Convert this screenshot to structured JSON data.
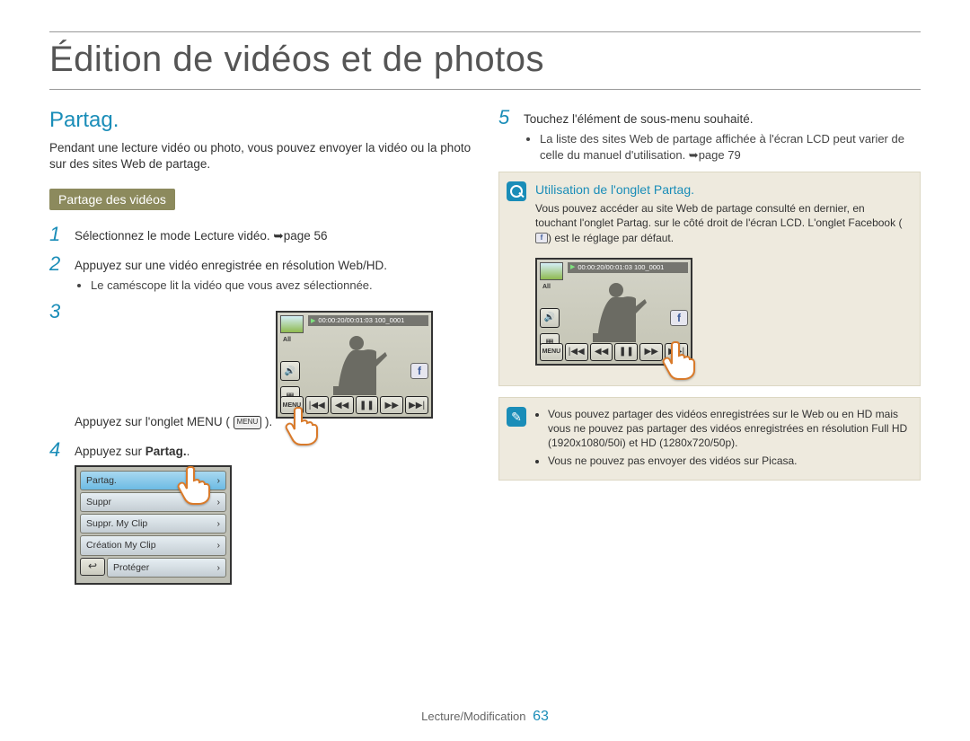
{
  "page_title": "Édition de vidéos et de photos",
  "section_heading": "Partag.",
  "intro": "Pendant une lecture vidéo ou photo, vous pouvez envoyer la vidéo ou la photo sur des sites Web de partage.",
  "sub_badge": "Partage des vidéos",
  "steps": {
    "1": {
      "text": "Sélectionnez le mode Lecture vidéo. ➥page 56"
    },
    "2": {
      "text": "Appuyez sur une vidéo enregistrée en résolution Web/HD.",
      "bullet": "Le caméscope lit la vidéo que vous avez sélectionnée."
    },
    "3": {
      "text_before": "Appuyez sur l'onglet MENU (",
      "text_after": ")."
    },
    "4": {
      "text_before": "Appuyez sur ",
      "bold": "Partag.",
      "text_after": "."
    },
    "5": {
      "text": "Touchez l'élément de sous-menu souhaité.",
      "bullet": "La liste des sites Web de partage affichée à l'écran LCD peut varier de celle du manuel d'utilisation. ➥page 79"
    }
  },
  "lcd": {
    "time_text": "00:00:20/00:01:03   100_0001",
    "all_label": "All",
    "menu_btn": "MENU",
    "fb_label": "f",
    "transport": {
      "prev": "|◀◀",
      "rew": "◀◀",
      "pause": "❚❚",
      "fwd": "▶▶",
      "next": "▶▶|"
    },
    "speaker_icon": "🔊",
    "grid_icon": "▦"
  },
  "menu_list": {
    "items": [
      "Partag.",
      "Suppr",
      "Suppr. My Clip",
      "Création My Clip"
    ],
    "last_row_item": "Protéger",
    "back_icon": "↩",
    "chevron": "›"
  },
  "info_onglet": {
    "title": "Utilisation de l'onglet Partag.",
    "body_1": "Vous pouvez accéder au site Web de partage consulté en dernier, en touchant l'onglet Partag. sur le côté droit de l'écran LCD. L'onglet Facebook (",
    "body_2": ") est le réglage par défaut."
  },
  "info_note": {
    "items": [
      "Vous pouvez partager des vidéos enregistrées sur le Web ou en HD mais vous ne pouvez pas partager des vidéos enregistrées en résolution Full HD (1920x1080/50i) et HD (1280x720/50p).",
      "Vous ne pouvez pas envoyer des vidéos sur Picasa."
    ]
  },
  "footer": {
    "section": "Lecture/Modification",
    "page_num": "63"
  }
}
